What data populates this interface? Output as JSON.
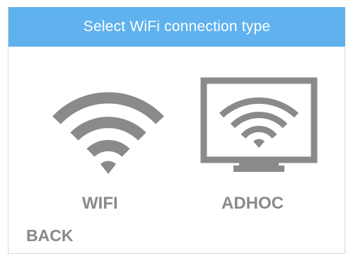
{
  "header": {
    "title": "Select WiFi connection type"
  },
  "options": [
    {
      "label": "WIFI",
      "icon": "wifi-icon"
    },
    {
      "label": "ADHOC",
      "icon": "monitor-wifi-icon"
    }
  ],
  "footer": {
    "back_label": "BACK"
  },
  "colors": {
    "header_bg": "#5fb2ee",
    "header_text": "#ffffff",
    "icon_gray": "#8a8a8a",
    "label_gray": "#8a8a8a"
  }
}
